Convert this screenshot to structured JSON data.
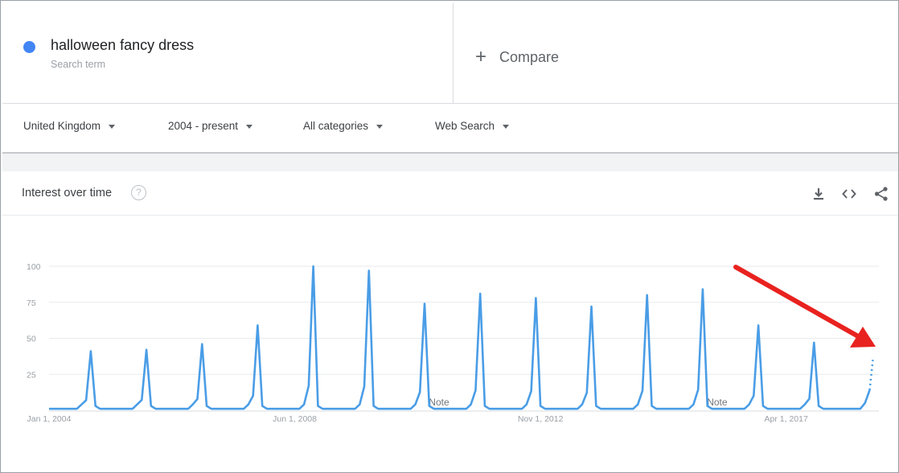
{
  "search_term": {
    "name": "halloween fancy dress",
    "subtitle": "Search term",
    "dot_color": "#4285f4"
  },
  "compare": {
    "label": "Compare",
    "icon": "plus-icon"
  },
  "filters": [
    {
      "label": "United Kingdom"
    },
    {
      "label": "2004 - present"
    },
    {
      "label": "All categories"
    },
    {
      "label": "Web Search"
    }
  ],
  "card": {
    "title": "Interest over time",
    "help_icon": "help-icon",
    "tools": [
      "download-icon",
      "embed-code-icon",
      "share-icon"
    ]
  },
  "chart_data": {
    "type": "line",
    "title": "",
    "xlabel": "",
    "ylabel": "",
    "ylim": [
      0,
      100
    ],
    "yticks": [
      "100",
      "75",
      "50",
      "25"
    ],
    "x_tick_labels": [
      "Jan 1, 2004",
      "Jun 1, 2008",
      "Nov 1, 2012",
      "Apr 1, 2017"
    ],
    "grid": true,
    "series": [
      {
        "color": "#4a9de6",
        "peaks": [
          {
            "x": "Oct 2004",
            "y": 41
          },
          {
            "x": "Oct 2005",
            "y": 42
          },
          {
            "x": "Oct 2006",
            "y": 46
          },
          {
            "x": "Oct 2007",
            "y": 59
          },
          {
            "x": "Oct 2008",
            "y": 100
          },
          {
            "x": "Oct 2009",
            "y": 97
          },
          {
            "x": "Oct 2010",
            "y": 74
          },
          {
            "x": "Oct 2011",
            "y": 81
          },
          {
            "x": "Oct 2012",
            "y": 78
          },
          {
            "x": "Oct 2013",
            "y": 72
          },
          {
            "x": "Oct 2014",
            "y": 80
          },
          {
            "x": "Oct 2015",
            "y": 84
          },
          {
            "x": "Oct 2016",
            "y": 59
          },
          {
            "x": "Oct 2017",
            "y": 47
          }
        ],
        "baseline": 1,
        "partial_end": {
          "x": "Oct 2018",
          "y": 14,
          "projected": 35
        }
      }
    ],
    "annotations": [
      {
        "label": "Note",
        "x": "Jan 2011"
      },
      {
        "label": "Note",
        "x": "Jan 2016"
      }
    ],
    "arrow_color": "#e8221f"
  }
}
